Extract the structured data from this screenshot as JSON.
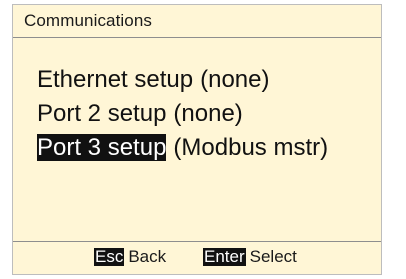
{
  "screen": {
    "title": "Communications"
  },
  "menu": {
    "items": [
      {
        "name": "Ethernet setup",
        "value": "(none)"
      },
      {
        "name": "Port 2 setup",
        "value": "(none)"
      },
      {
        "name": "Port 3 setup",
        "value": "(Modbus mstr)"
      }
    ],
    "selected_index": 2
  },
  "footer": {
    "esc": {
      "key": "Esc",
      "label": "Back"
    },
    "enter": {
      "key": "Enter",
      "label": "Select"
    }
  },
  "colors": {
    "background": "#fff6d6",
    "highlight": "#111111",
    "highlight_text": "#ffffff"
  }
}
